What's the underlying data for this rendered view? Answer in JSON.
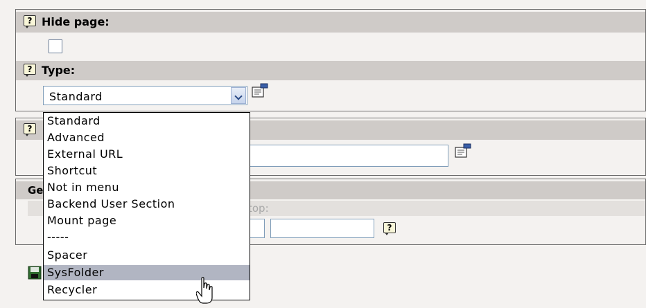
{
  "fields": {
    "hide_page": {
      "label": "Hide page:",
      "checked": false
    },
    "type": {
      "label": "Type:",
      "selected": "Standard"
    }
  },
  "partial": {
    "general_prefix": "Ge",
    "stop_label_fragment": "top:"
  },
  "dropdown": {
    "options": [
      "Standard",
      "Advanced",
      "External URL",
      "Shortcut",
      "Not in menu",
      "Backend User Section",
      "Mount page",
      "-----",
      "Spacer",
      "SysFolder",
      "Recycler"
    ],
    "highlighted": "SysFolder"
  },
  "icons": {
    "help": "help-icon",
    "edit": "edit-record-icon",
    "save": "save-icon",
    "cursor": "hand-pointer-icon"
  },
  "colors": {
    "panel_bg": "#f4f2f0",
    "header_bar": "#cfcbc8",
    "highlight": "#b1b5c2"
  }
}
